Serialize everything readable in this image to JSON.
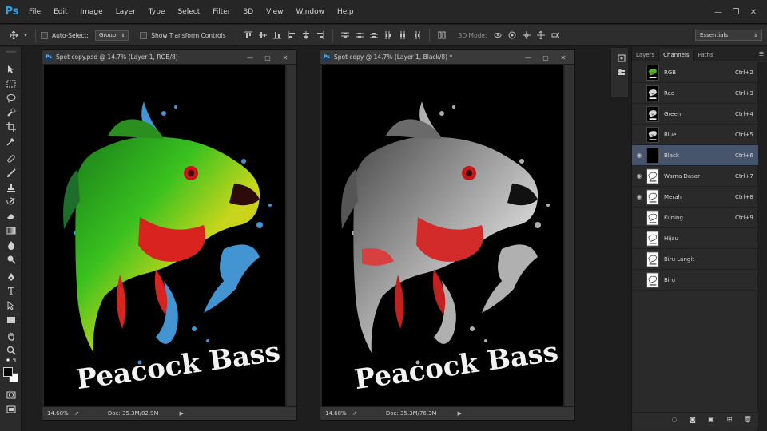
{
  "app": {
    "logo": "Ps",
    "menus": [
      "File",
      "Edit",
      "Image",
      "Layer",
      "Type",
      "Select",
      "Filter",
      "3D",
      "View",
      "Window",
      "Help"
    ]
  },
  "options": {
    "auto_select_label": "Auto-Select:",
    "auto_select_value": "Group",
    "show_transform_label": "Show Transform Controls",
    "mode_3d_label": "3D Mode:",
    "workspace": "Essentials"
  },
  "documents": [
    {
      "badge": "Ps",
      "title": "Spot copy.psd @ 14.7% (Layer 1, RGB/8)",
      "zoom": "14.68%",
      "doc_size": "Doc: 35.3M/82.9M"
    },
    {
      "badge": "Ps",
      "title": "Spot copy @ 14.7% (Layer 1, Black/8) *",
      "zoom": "14.68%",
      "doc_size": "Doc: 35.3M/76.3M"
    }
  ],
  "artwork_text": "Peacock Bass",
  "panel": {
    "tabs": [
      "Layers",
      "Channels",
      "Paths"
    ],
    "active_tab": "Channels",
    "channels": [
      {
        "name": "RGB",
        "shortcut": "Ctrl+2",
        "visible": false,
        "selected": false,
        "thumb": "rgb"
      },
      {
        "name": "Red",
        "shortcut": "Ctrl+3",
        "visible": false,
        "selected": false,
        "thumb": "mask"
      },
      {
        "name": "Green",
        "shortcut": "Ctrl+4",
        "visible": false,
        "selected": false,
        "thumb": "mask"
      },
      {
        "name": "Blue",
        "shortcut": "Ctrl+5",
        "visible": false,
        "selected": false,
        "thumb": "mask"
      },
      {
        "name": "Black",
        "shortcut": "Ctrl+6",
        "visible": true,
        "selected": true,
        "thumb": "black"
      },
      {
        "name": "Warna Dasar",
        "shortcut": "Ctrl+7",
        "visible": true,
        "selected": false,
        "thumb": "spot"
      },
      {
        "name": "Merah",
        "shortcut": "Ctrl+8",
        "visible": true,
        "selected": false,
        "thumb": "spot"
      },
      {
        "name": "Kuning",
        "shortcut": "Ctrl+9",
        "visible": false,
        "selected": false,
        "thumb": "spot"
      },
      {
        "name": "Hijau",
        "shortcut": "",
        "visible": false,
        "selected": false,
        "thumb": "spot"
      },
      {
        "name": "Biru Langit",
        "shortcut": "",
        "visible": false,
        "selected": false,
        "thumb": "spot"
      },
      {
        "name": "Biru",
        "shortcut": "",
        "visible": false,
        "selected": false,
        "thumb": "spot"
      }
    ]
  },
  "colors": {
    "accent": "#2fa0e6",
    "selected_row": "#46546c"
  }
}
